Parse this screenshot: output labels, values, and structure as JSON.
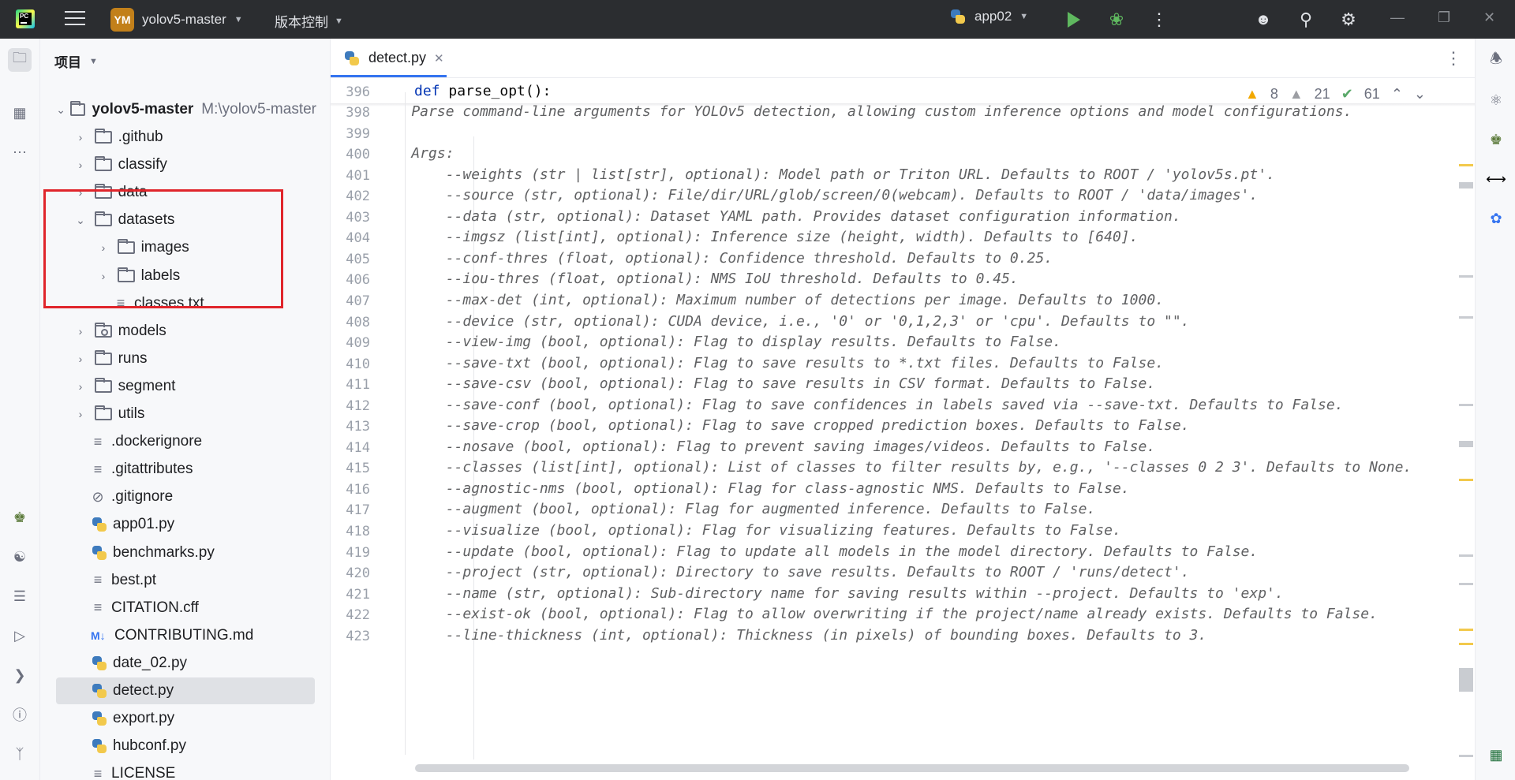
{
  "titlebar": {
    "project_initials": "YM",
    "project_name": "yolov5-master",
    "vcs_label": "版本控制",
    "run_config": "app02"
  },
  "sidebar": {
    "header": "项目",
    "root": {
      "name": "yolov5-master",
      "path": "M:\\yolov5-master"
    },
    "items": [
      {
        "label": ".github",
        "type": "folder"
      },
      {
        "label": "classify",
        "type": "folder"
      },
      {
        "label": "data",
        "type": "folder"
      },
      {
        "label": "datasets",
        "type": "folder",
        "expanded": true
      },
      {
        "label": "images",
        "type": "folder"
      },
      {
        "label": "labels",
        "type": "folder"
      },
      {
        "label": "classes.txt",
        "type": "text"
      },
      {
        "label": "models",
        "type": "module-folder"
      },
      {
        "label": "runs",
        "type": "folder"
      },
      {
        "label": "segment",
        "type": "folder"
      },
      {
        "label": "utils",
        "type": "folder"
      },
      {
        "label": ".dockerignore",
        "type": "text"
      },
      {
        "label": ".gitattributes",
        "type": "text"
      },
      {
        "label": ".gitignore",
        "type": "ignore"
      },
      {
        "label": "app01.py",
        "type": "python"
      },
      {
        "label": "benchmarks.py",
        "type": "python"
      },
      {
        "label": "best.pt",
        "type": "text"
      },
      {
        "label": "CITATION.cff",
        "type": "text"
      },
      {
        "label": "CONTRIBUTING.md",
        "type": "markdown"
      },
      {
        "label": "date_02.py",
        "type": "python"
      },
      {
        "label": "detect.py",
        "type": "python",
        "selected": true
      },
      {
        "label": "export.py",
        "type": "python"
      },
      {
        "label": "hubconf.py",
        "type": "python"
      },
      {
        "label": "LICENSE",
        "type": "text"
      }
    ],
    "md_badge": "M↓"
  },
  "editor": {
    "tab_label": "detect.py",
    "inspections": {
      "warnings": "8",
      "weak_warnings": "21",
      "ok": "61"
    },
    "sticky": {
      "line": "396",
      "kw": "def",
      "text": " parse_opt():"
    },
    "lines": [
      {
        "n": "398",
        "text": "    Parse command-line arguments for YOLOv5 detection, allowing custom inference options and model configurations."
      },
      {
        "n": "399",
        "text": ""
      },
      {
        "n": "400",
        "text": "    Args:"
      },
      {
        "n": "401",
        "text": "        --weights (str | list[str], optional): Model path or Triton URL. Defaults to ROOT / 'yolov5s.pt'."
      },
      {
        "n": "402",
        "text": "        --source (str, optional): File/dir/URL/glob/screen/0(webcam). Defaults to ROOT / 'data/images'."
      },
      {
        "n": "403",
        "text": "        --data (str, optional): Dataset YAML path. Provides dataset configuration information."
      },
      {
        "n": "404",
        "text": "        --imgsz (list[int], optional): Inference size (height, width). Defaults to [640]."
      },
      {
        "n": "405",
        "text": "        --conf-thres (float, optional): Confidence threshold. Defaults to 0.25."
      },
      {
        "n": "406",
        "text": "        --iou-thres (float, optional): NMS IoU threshold. Defaults to 0.45."
      },
      {
        "n": "407",
        "text": "        --max-det (int, optional): Maximum number of detections per image. Defaults to 1000."
      },
      {
        "n": "408",
        "text": "        --device (str, optional): CUDA device, i.e., '0' or '0,1,2,3' or 'cpu'. Defaults to \"\"."
      },
      {
        "n": "409",
        "text": "        --view-img (bool, optional): Flag to display results. Defaults to False."
      },
      {
        "n": "410",
        "text": "        --save-txt (bool, optional): Flag to save results to *.txt files. Defaults to False."
      },
      {
        "n": "411",
        "text": "        --save-csv (bool, optional): Flag to save results in CSV format. Defaults to False."
      },
      {
        "n": "412",
        "text": "        --save-conf (bool, optional): Flag to save confidences in labels saved via --save-txt. Defaults to False."
      },
      {
        "n": "413",
        "text": "        --save-crop (bool, optional): Flag to save cropped prediction boxes. Defaults to False."
      },
      {
        "n": "414",
        "text": "        --nosave (bool, optional): Flag to prevent saving images/videos. Defaults to False."
      },
      {
        "n": "415",
        "text": "        --classes (list[int], optional): List of classes to filter results by, e.g., '--classes 0 2 3'. Defaults to None."
      },
      {
        "n": "416",
        "text": "        --agnostic-nms (bool, optional): Flag for class-agnostic NMS. Defaults to False."
      },
      {
        "n": "417",
        "text": "        --augment (bool, optional): Flag for augmented inference. Defaults to False."
      },
      {
        "n": "418",
        "text": "        --visualize (bool, optional): Flag for visualizing features. Defaults to False."
      },
      {
        "n": "419",
        "text": "        --update (bool, optional): Flag to update all models in the model directory. Defaults to False."
      },
      {
        "n": "420",
        "text": "        --project (str, optional): Directory to save results. Defaults to ROOT / 'runs/detect'."
      },
      {
        "n": "421",
        "text": "        --name (str, optional): Sub-directory name for saving results within --project. Defaults to 'exp'."
      },
      {
        "n": "422",
        "text": "        --exist-ok (bool, optional): Flag to allow overwriting if the project/name already exists. Defaults to False."
      },
      {
        "n": "423",
        "text": "        --line-thickness (int, optional): Thickness (in pixels) of bounding boxes. Defaults to 3."
      }
    ]
  },
  "colors": {
    "highlight_box": "#e0252b",
    "accent": "#3574f0",
    "warning": "#f2a800"
  }
}
